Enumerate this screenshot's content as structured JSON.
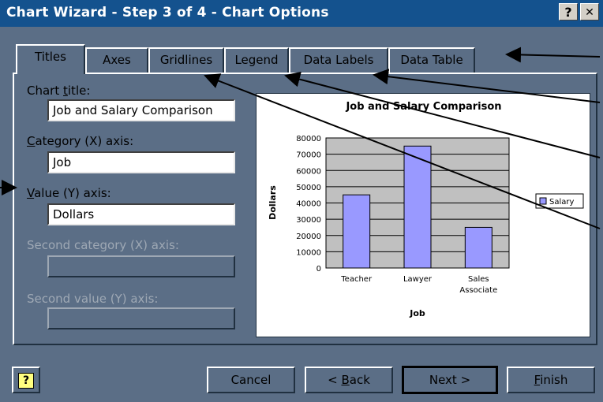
{
  "window": {
    "title": "Chart Wizard - Step 3 of 4 - Chart Options",
    "help_glyph": "?",
    "close_glyph": "✕"
  },
  "tabs": [
    "Titles",
    "Axes",
    "Gridlines",
    "Legend",
    "Data Labels",
    "Data Table"
  ],
  "fields": {
    "chart_title_label": "Chart title:",
    "chart_title_value": "Job and Salary Comparison",
    "category_x_label": "Category (X) axis:",
    "category_x_value": "Job",
    "value_y_label": "Value (Y) axis:",
    "value_y_value": "Dollars",
    "second_category_label": "Second category (X) axis:",
    "second_value_label": "Second value (Y) axis:"
  },
  "buttons": {
    "cancel": "Cancel",
    "back": "< Back",
    "next": "Next >",
    "finish": "Finish",
    "help_icon": "?"
  },
  "colors": {
    "titlebar": "#14528e",
    "dialog_bg": "#5b6e86",
    "bar": "#9999ff",
    "plot_bg": "#c0c0c0"
  },
  "chart_data": {
    "type": "bar",
    "title": "Job and Salary Comparison",
    "xlabel": "Job",
    "ylabel": "Dollars",
    "categories": [
      "Teacher",
      "Lawyer",
      "Sales Associate"
    ],
    "series": [
      {
        "name": "Salary",
        "values": [
          45000,
          75000,
          25000
        ]
      }
    ],
    "ylim": [
      0,
      80000
    ],
    "yticks": [
      "0",
      "10000",
      "20000",
      "30000",
      "40000",
      "50000",
      "60000",
      "70000",
      "80000"
    ],
    "grid": true,
    "legend": "right"
  }
}
